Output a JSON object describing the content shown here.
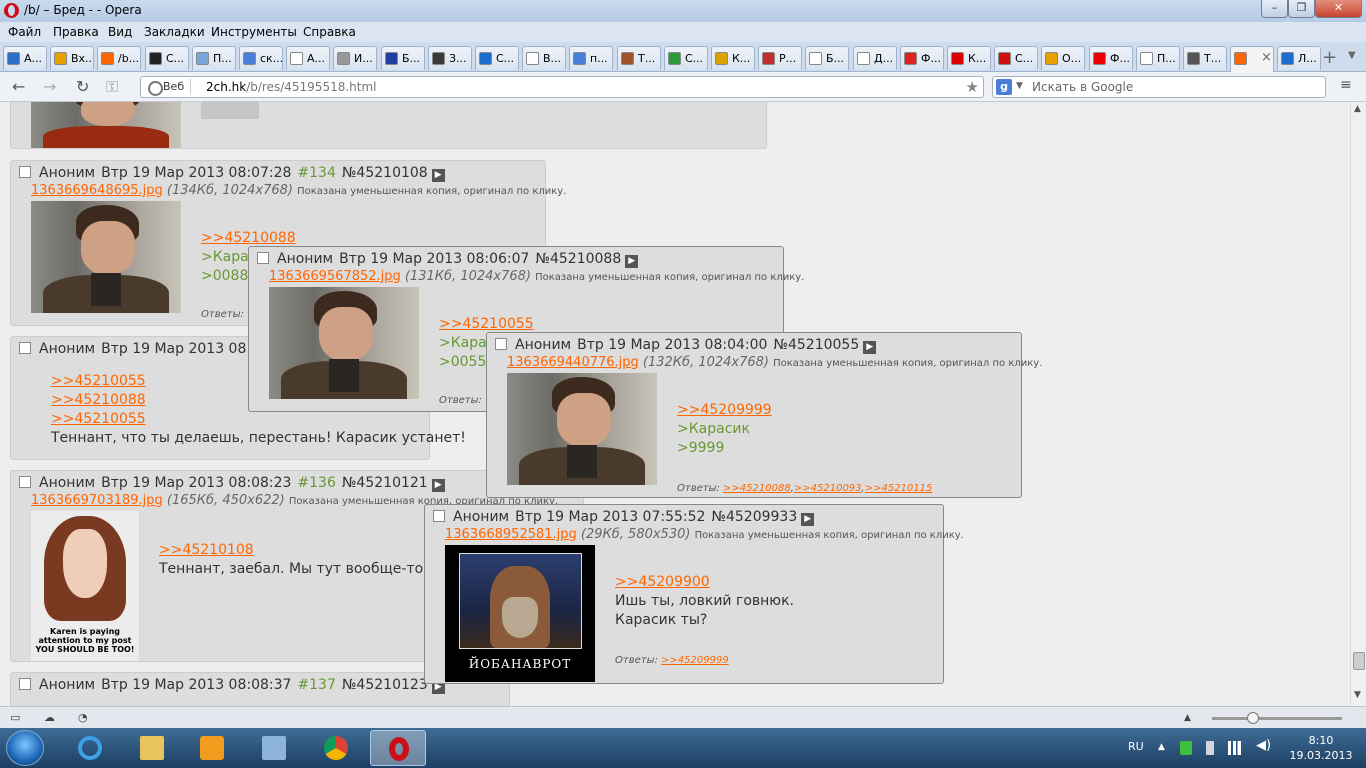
{
  "window": {
    "title": "/b/ – Бред - - Opera"
  },
  "menu": [
    "Файл",
    "Правка",
    "Вид",
    "Закладки",
    "Инструменты",
    "Справка"
  ],
  "tabs": [
    {
      "label": "А...",
      "color": "#2a6fc9"
    },
    {
      "label": "Вх...",
      "color": "#e8a000"
    },
    {
      "label": "/b...",
      "color": "#ff6600"
    },
    {
      "label": "С...",
      "color": "#222222"
    },
    {
      "label": "П...",
      "color": "#7aa7d8"
    },
    {
      "label": "ск...",
      "color": "#4a7fd8"
    },
    {
      "label": "А...",
      "color": "#ffffff"
    },
    {
      "label": "И...",
      "color": "#999999"
    },
    {
      "label": "Б...",
      "color": "#1f3fa5"
    },
    {
      "label": "З...",
      "color": "#3a3a3a"
    },
    {
      "label": "С...",
      "color": "#1e6ccf"
    },
    {
      "label": "В...",
      "color": "#ffffff"
    },
    {
      "label": "п...",
      "color": "#4a7fd8"
    },
    {
      "label": "Т...",
      "color": "#a0522d"
    },
    {
      "label": "С...",
      "color": "#2b9a3a"
    },
    {
      "label": "К...",
      "color": "#d9a400"
    },
    {
      "label": "Р...",
      "color": "#c22d2d"
    },
    {
      "label": "Б...",
      "color": "#ffffff"
    },
    {
      "label": "Д...",
      "color": "#ffffff"
    },
    {
      "label": "Ф...",
      "color": "#d22"
    },
    {
      "label": "К...",
      "color": "#d00"
    },
    {
      "label": "С...",
      "color": "#c11"
    },
    {
      "label": "О...",
      "color": "#e8a000"
    },
    {
      "label": "Ф...",
      "color": "#e00"
    },
    {
      "label": "П...",
      "color": "#ffffff"
    },
    {
      "label": "Т...",
      "color": "#555555"
    },
    {
      "label": "",
      "color": "#ff6600"
    },
    {
      "label": "Л...",
      "color": "#1e6ccf"
    }
  ],
  "address": {
    "badge": "Веб",
    "host": "2ch.hk",
    "path": "/b/res/45195518.html"
  },
  "search": {
    "placeholder": "Искать в Google",
    "engine_letter": "g"
  },
  "posts": {
    "p134": {
      "name": "Аноним",
      "date": "Втр 19 Мар 2013 08:07:28",
      "num": "#134",
      "pid": "№45210108",
      "file": "1363669648695.jpg",
      "meta": "(134Кб, 1024x768)",
      "note": "Показана уменьшенная копия, оригинал по клику.",
      "ref": ">>45210088",
      "quote1": ">Кара",
      "quote2": ">0088",
      "replies_label": "Ответы:"
    },
    "p135": {
      "name": "Аноним",
      "date": "Втр 19 Мар 2013 08",
      "refs": [
        ">>45210055",
        ">>45210088",
        ">>45210055"
      ],
      "text": "Теннант, что ты делаешь, перестань! Карасик устанет!"
    },
    "p136": {
      "name": "Аноним",
      "date": "Втр 19 Мар 2013 08:08:23",
      "num": "#136",
      "pid": "№45210121",
      "file": "1363669703189.jpg",
      "meta": "(165Кб, 450x622)",
      "note": "Показана уменьшенная копия, оригинал по клику.",
      "ref": ">>45210108",
      "text": "Теннант, заебал. Мы тут вообще-то",
      "caption1": "Karen is paying",
      "caption2": "attention to my post",
      "caption3": "YOU SHOULD BE TOO!"
    },
    "p137": {
      "name": "Аноним",
      "date": "Втр 19 Мар 2013 08:08:37",
      "num": "#137",
      "pid": "№45210123"
    }
  },
  "previews": {
    "a": {
      "name": "Аноним",
      "date": "Втр 19 Мар 2013 08:06:07",
      "pid": "№45210088",
      "file": "1363669567852.jpg",
      "meta": "(131Кб, 1024x768)",
      "note": "Показана уменьшенная копия, оригинал по клику.",
      "ref": ">>45210055",
      "quote1": ">Кара",
      "quote2": ">0055",
      "replies_label": "Ответы:"
    },
    "b": {
      "name": "Аноним",
      "date": "Втр 19 Мар 2013 08:04:00",
      "pid": "№45210055",
      "file": "1363669440776.jpg",
      "meta": "(132Кб, 1024x768)",
      "note": "Показана уменьшенная копия, оригинал по клику.",
      "ref": ">>45209999",
      "quote1": ">Карасик",
      "quote2": ">9999",
      "replies_label": "Ответы:",
      "replies": [
        ">>45210088",
        ">>45210093",
        ">>45210115"
      ]
    },
    "c": {
      "name": "Аноним",
      "date": "Втр 19 Мар 2013 07:55:52",
      "pid": "№45209933",
      "file": "1363668952581.jpg",
      "meta": "(29Кб, 580x530)",
      "note": "Показана уменьшенная копия, оригинал по клику.",
      "ref": ">>45209900",
      "text1": "Ишь ты, ловкий говнюк.",
      "text2": "Карасик ты?",
      "caption": "ЙОБАНАВРОТ",
      "replies_label": "Ответы:",
      "replies": [
        ">>45209999"
      ]
    }
  },
  "taskbar": {
    "lang": "RU",
    "time": "8:10",
    "date": "19.03.2013"
  }
}
